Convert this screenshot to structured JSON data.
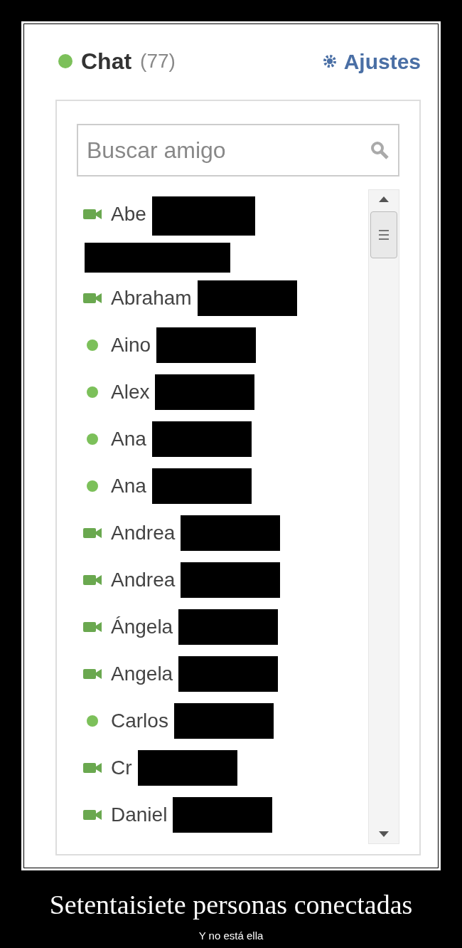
{
  "header": {
    "title": "Chat",
    "count": "(77)",
    "settings": "Ajustes"
  },
  "search": {
    "placeholder": "Buscar amigo"
  },
  "contacts": [
    {
      "name": "Abe",
      "kind": "video",
      "redacted": true,
      "redaction_wraps": true
    },
    {
      "name": "Abraham",
      "kind": "video",
      "redacted": true,
      "redaction_wraps": false
    },
    {
      "name": "Aino",
      "kind": "online",
      "redacted": true,
      "redaction_wraps": false
    },
    {
      "name": "Alex",
      "kind": "online",
      "redacted": true,
      "redaction_wraps": false
    },
    {
      "name": "Ana",
      "kind": "online",
      "redacted": true,
      "redaction_wraps": false
    },
    {
      "name": "Ana",
      "kind": "online",
      "redacted": true,
      "redaction_wraps": false
    },
    {
      "name": "Andrea",
      "kind": "video",
      "redacted": true,
      "redaction_wraps": false
    },
    {
      "name": "Andrea",
      "kind": "video",
      "redacted": true,
      "redaction_wraps": false
    },
    {
      "name": "Ángela",
      "kind": "video",
      "redacted": true,
      "redaction_wraps": false
    },
    {
      "name": "Angela",
      "kind": "video",
      "redacted": true,
      "redaction_wraps": false
    },
    {
      "name": "Carlos",
      "kind": "online",
      "redacted": true,
      "redaction_wraps": false
    },
    {
      "name": "Cr",
      "kind": "video",
      "redacted": true,
      "redaction_wraps": false
    },
    {
      "name": "Daniel",
      "kind": "video",
      "redacted": true,
      "redaction_wraps": false
    }
  ],
  "caption": {
    "title": "Setentaisiete personas conectadas",
    "subtitle": "Y no está ella"
  }
}
